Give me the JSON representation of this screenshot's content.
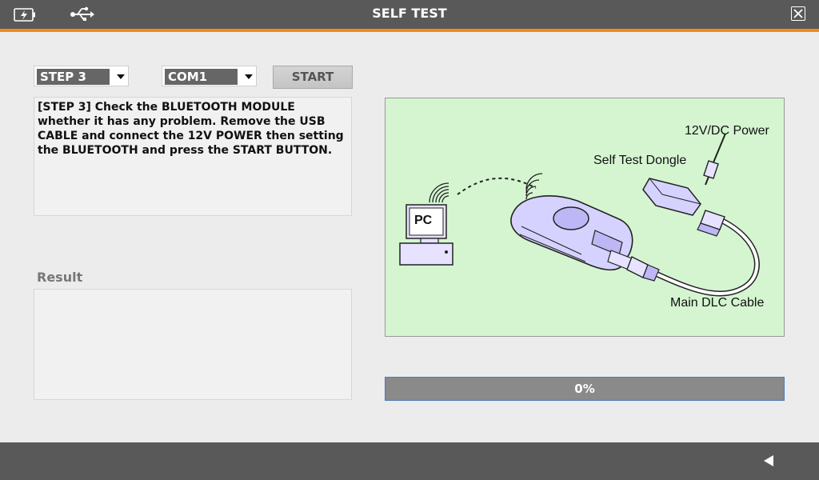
{
  "window": {
    "title": "SELF TEST",
    "accent_color": "#f28a1c",
    "bar_color": "#595959"
  },
  "icons": {
    "battery": "battery-icon",
    "usb": "usb-icon",
    "close": "close-icon",
    "back": "back-arrow-icon"
  },
  "controls": {
    "step_select": {
      "value": "STEP 3"
    },
    "com_select": {
      "value": "COM1"
    },
    "start_label": "START"
  },
  "instruction": "[STEP 3] Check the BLUETOOTH MODULE whether it has any problem. Remove the USB CABLE and connect the 12V POWER then setting the BLUETOOTH and press the START BUTTON.",
  "result": {
    "label": "Result",
    "value": ""
  },
  "diagram": {
    "pc_label": "PC",
    "power_label": "12V/DC Power",
    "dongle_label": "Self Test Dongle",
    "cable_label": "Main DLC Cable",
    "background_color": "#d4f5d0"
  },
  "progress": {
    "value": 0,
    "text": "0%"
  }
}
